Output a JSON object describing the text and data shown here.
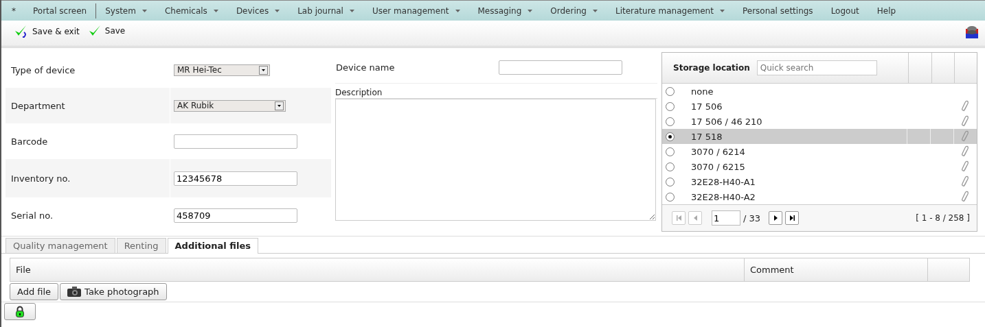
{
  "menu": [
    {
      "label": "*",
      "dropdown": false
    },
    {
      "label": "Portal screen",
      "dropdown": false
    },
    {
      "label": "System",
      "dropdown": true
    },
    {
      "label": "Chemicals",
      "dropdown": true
    },
    {
      "label": "Devices",
      "dropdown": true
    },
    {
      "label": "Lab journal",
      "dropdown": true
    },
    {
      "label": "User management",
      "dropdown": true
    },
    {
      "label": "Messaging",
      "dropdown": true
    },
    {
      "label": "Ordering",
      "dropdown": true
    },
    {
      "label": "Literature management",
      "dropdown": true
    },
    {
      "label": "Personal settings",
      "dropdown": false
    },
    {
      "label": "Logout",
      "dropdown": false
    },
    {
      "label": "Help",
      "dropdown": false
    }
  ],
  "toolbar": [
    {
      "label": "Save & exit",
      "kind": "save-exit"
    },
    {
      "label": "Save",
      "kind": "save"
    }
  ],
  "form": [
    {
      "label": "Type of device",
      "kind": "select",
      "value": "MR Hei-Tec"
    },
    {
      "label": "Department",
      "kind": "select",
      "value": "AK Rubik"
    },
    {
      "label": "Barcode",
      "kind": "text"
    },
    {
      "label": "Inventory no.",
      "kind": "text",
      "value": "12345678"
    },
    {
      "label": "Serial no.",
      "kind": "text",
      "value": "458709"
    }
  ],
  "device_name": {
    "label": "Device name"
  },
  "description": {
    "label": "Description"
  },
  "storage": {
    "title": "Storage location",
    "search": {
      "placeholder": "Quick search"
    },
    "rows": [
      {
        "name": "none",
        "selected": false,
        "attachment": false
      },
      {
        "name": "17 506",
        "selected": false,
        "attachment": true
      },
      {
        "name": "17 506 / 46 210",
        "selected": false,
        "attachment": true
      },
      {
        "name": "17 518",
        "selected": true,
        "attachment": true
      },
      {
        "name": "3070 / 6214",
        "selected": false,
        "attachment": true
      },
      {
        "name": "3070 / 6215",
        "selected": false,
        "attachment": true
      },
      {
        "name": "32E28-H40-A1",
        "selected": false,
        "attachment": true
      },
      {
        "name": "32E28-H40-A2",
        "selected": false,
        "attachment": true
      }
    ],
    "page": "1",
    "pages": "/ 33",
    "range": "[ 1 - 8 / 258 ]"
  },
  "tabs": [
    {
      "label": "Quality management",
      "selected": false
    },
    {
      "label": "Renting",
      "selected": false
    },
    {
      "label": "Additional files",
      "selected": true
    }
  ],
  "files_table": {
    "columns": [
      "File",
      "Comment"
    ]
  },
  "buttons": [
    {
      "label": "Add file",
      "kind": "plain"
    },
    {
      "label": "Take photograph",
      "kind": "camera"
    }
  ]
}
